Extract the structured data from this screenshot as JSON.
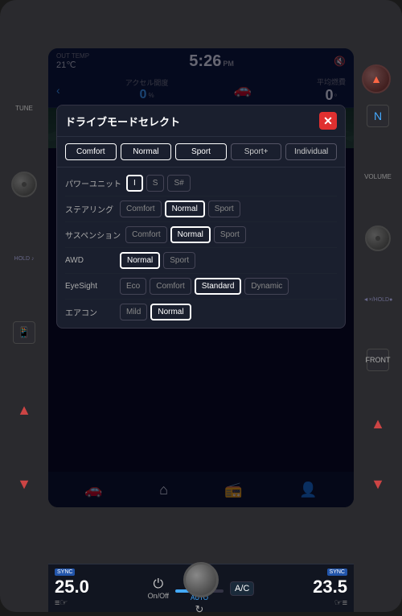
{
  "status": {
    "out_temp_label": "OUT TEMP",
    "temperature": "21℃",
    "time": "5:26",
    "time_pm": "PM",
    "mute": "🔇",
    "accel_label": "アクセル開度",
    "economy_label": "平均燃費",
    "accel_val": "0",
    "accel_unit": "%",
    "angle_val": "0",
    "angle_unit": "°"
  },
  "modal": {
    "title": "ドライブモードセレクト",
    "close_label": "✕",
    "top_modes": [
      "Comfort",
      "Normal",
      "Sport",
      "Sport+",
      "Individual"
    ],
    "rows": [
      {
        "label": "パワーユニット",
        "options": [
          "I",
          "S",
          "S#"
        ],
        "selected": "I"
      },
      {
        "label": "ステアリング",
        "options": [
          "Comfort",
          "Normal",
          "Sport"
        ],
        "selected": "Normal"
      },
      {
        "label": "サスペンション",
        "options": [
          "Comfort",
          "Normal",
          "Sport"
        ],
        "selected": "Normal"
      },
      {
        "label": "AWD",
        "options": [
          "Normal",
          "Sport"
        ],
        "selected": "Normal"
      },
      {
        "label": "EyeSight",
        "options": [
          "Eco",
          "Comfort",
          "Standard",
          "Dynamic"
        ],
        "selected": "Standard"
      },
      {
        "label": "エアコン",
        "options": [
          "Mild",
          "Normal"
        ],
        "selected": "Normal"
      }
    ]
  },
  "climate": {
    "left_temp": "25.0",
    "right_temp": "23.5",
    "sync_label": "SYNC",
    "on_off": "On/Off",
    "ac_label": "A/C",
    "auto_label": "AUTO"
  },
  "nav": {
    "items": [
      "🚗",
      "🏠",
      "📻",
      "👤"
    ]
  },
  "side_left": {
    "tune_label": "TUNE",
    "hold_label": "HOLD ♪"
  },
  "side_right": {
    "volume_label": "VOLUME",
    "hold_label": "◄×/HOLD●"
  }
}
